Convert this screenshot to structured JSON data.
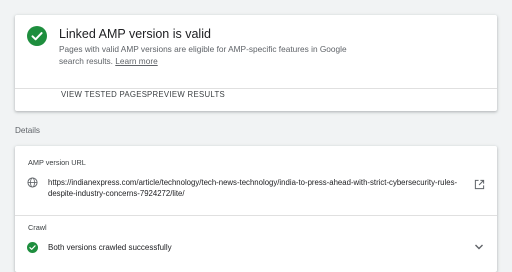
{
  "status": {
    "title": "Linked AMP version is valid",
    "description": "Pages with valid AMP versions are eligible for AMP-specific features in Google search results.",
    "learn_more": "Learn more",
    "icon": "check-circle-icon",
    "color": "#1e8e3e"
  },
  "actions": {
    "view_tested": "VIEW TESTED PAGES",
    "preview_results": "PREVIEW RESULTS"
  },
  "details": {
    "label": "Details",
    "amp_url_label": "AMP version URL",
    "amp_url": "https://indianexpress.com/article/technology/tech-news-technology/india-to-press-ahead-with-strict-cybersecurity-rules-despite-industry-concerns-7924272/lite/",
    "crawl_label": "Crawl",
    "crawl_status": "Both versions crawled successfully"
  }
}
